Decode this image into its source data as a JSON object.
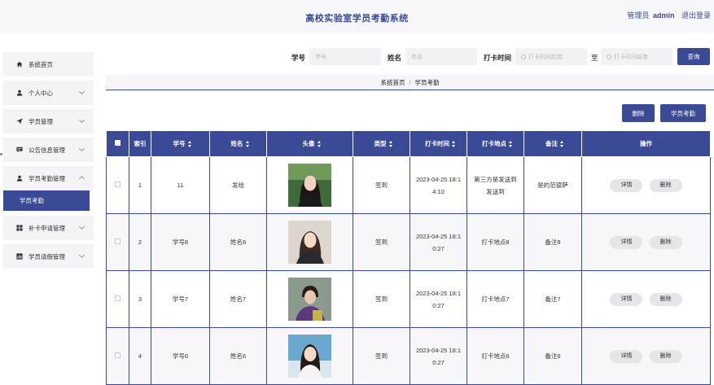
{
  "header": {
    "title": "高校实验室学员考勤系统",
    "role": "管理员",
    "username": "admin",
    "logout": "退出登录",
    "bg_color": "#f7f7f9",
    "accent": "#3a4a94"
  },
  "sidebar": {
    "items": [
      {
        "label": "系统首页",
        "icon": "home-icon"
      },
      {
        "label": "个人中心",
        "icon": "user-icon"
      },
      {
        "label": "学员管理",
        "icon": "send-icon"
      },
      {
        "label": "公告信息管理",
        "icon": "message-icon"
      },
      {
        "label": "学员考勤管理",
        "icon": "user-icon",
        "expanded": true
      },
      {
        "label": "补卡申请管理",
        "icon": "grid-icon"
      },
      {
        "label": "学员请假管理",
        "icon": "chart-icon"
      }
    ],
    "active_sub": "学员考勤"
  },
  "search": {
    "student_id_label": "学号",
    "student_id_placeholder": "学号",
    "name_label": "姓名",
    "name_placeholder": "姓名",
    "time_label": "打卡时间",
    "start_placeholder": "打卡时间起始",
    "to_label": "至",
    "end_placeholder": "打卡时间结束",
    "query_button": "查询"
  },
  "breadcrumb": {
    "home": "系统首页",
    "separator": "/",
    "current": "学员考勤"
  },
  "actions": {
    "delete": "删除",
    "attendance": "学员考勤"
  },
  "table": {
    "columns": [
      "索引",
      "学号",
      "姓名",
      "头像",
      "类型",
      "打卡时间",
      "打卡地点",
      "备注",
      "操作"
    ],
    "rows": [
      {
        "index": "1",
        "student_id": "11",
        "name": "发给",
        "avatar": "avatar-photo-1",
        "type": "签到",
        "time_a": "2023-04-25 18:1",
        "time_b": "4:10",
        "place_a": "第三方是发送到",
        "place_b": "发送到",
        "note": "是的范德萨"
      },
      {
        "index": "2",
        "student_id": "学号8",
        "name": "姓名8",
        "avatar": "avatar-photo-2",
        "type": "签到",
        "time_a": "2023-04-25 18:1",
        "time_b": "0:27",
        "place_a": "打卡地点8",
        "place_b": "",
        "note": "备注8"
      },
      {
        "index": "3",
        "student_id": "学号7",
        "name": "姓名7",
        "avatar": "avatar-photo-3",
        "type": "签到",
        "time_a": "2023-04-25 18:1",
        "time_b": "0:27",
        "place_a": "打卡地点7",
        "place_b": "",
        "note": "备注7"
      },
      {
        "index": "4",
        "student_id": "学号6",
        "name": "姓名6",
        "avatar": "avatar-photo-4",
        "type": "签到",
        "time_a": "2023-04-25 18:1",
        "time_b": "0:27",
        "place_a": "打卡地点6",
        "place_b": "",
        "note": "备注6"
      }
    ],
    "detail_label": "详情",
    "delete_label": "删除"
  }
}
